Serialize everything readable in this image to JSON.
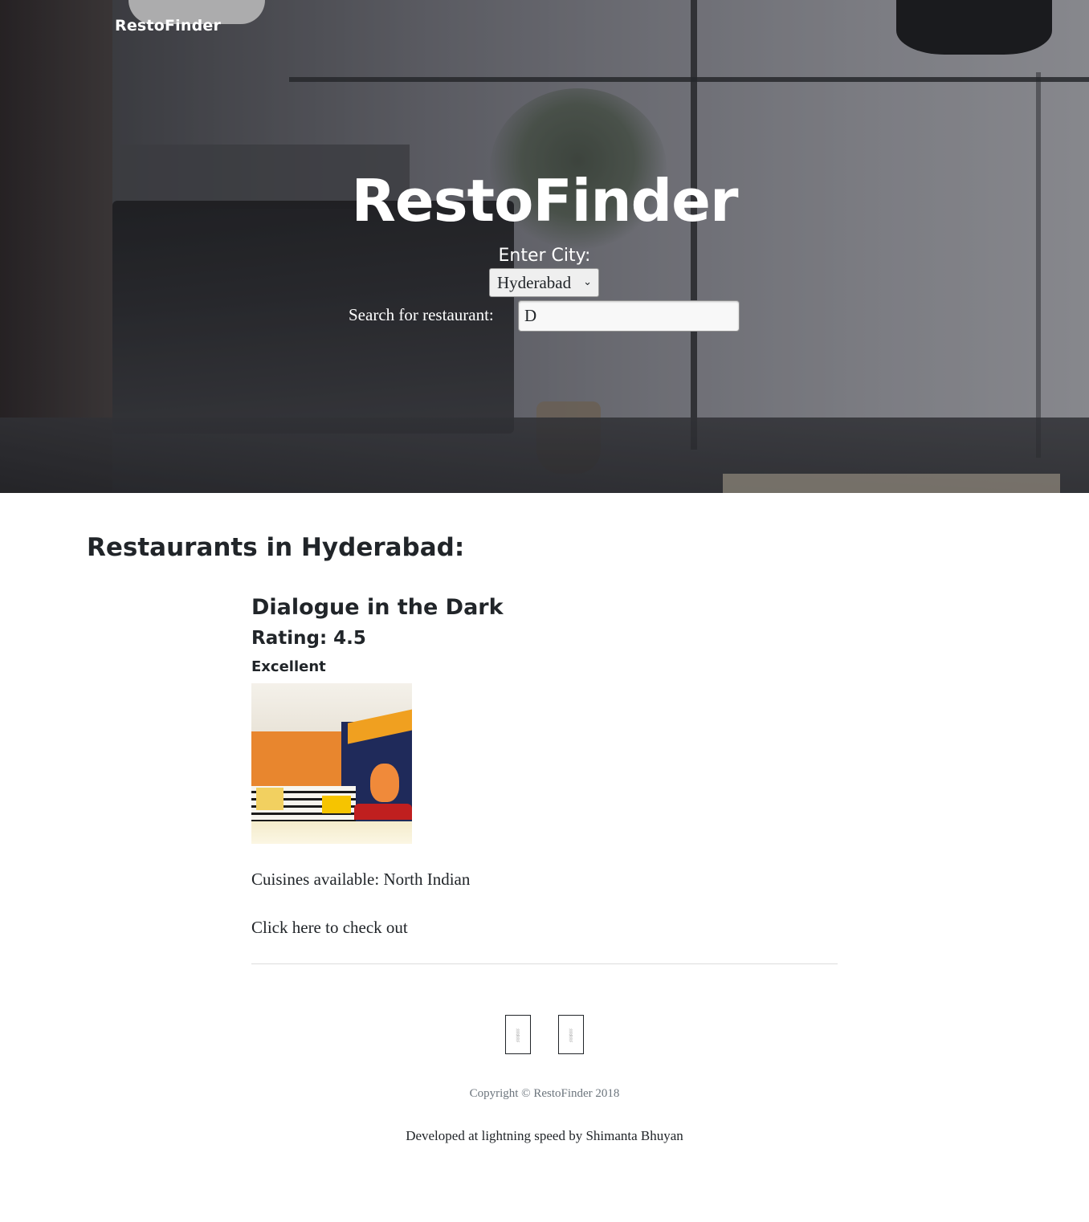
{
  "navbar": {
    "brand": "RestoFinder"
  },
  "hero": {
    "title": "RestoFinder",
    "city_label": "Enter City:",
    "city_selected": "Hyderabad",
    "search_label": "Search for restaurant:",
    "search_value": "D"
  },
  "results": {
    "heading": "Restaurants in Hyderabad:",
    "restaurants": [
      {
        "name": "Dialogue in the Dark",
        "rating": "Rating: 4.5",
        "rating_text": "Excellent",
        "cuisines": "Cuisines available: North Indian",
        "link_label": "Click here to check out"
      }
    ]
  },
  "footer": {
    "social_icons": [
      "social-icon-1",
      "social-icon-2"
    ],
    "copyright": "Copyright © RestoFinder 2018",
    "developed_by": "Developed at lightning speed by Shimanta Bhuyan"
  }
}
